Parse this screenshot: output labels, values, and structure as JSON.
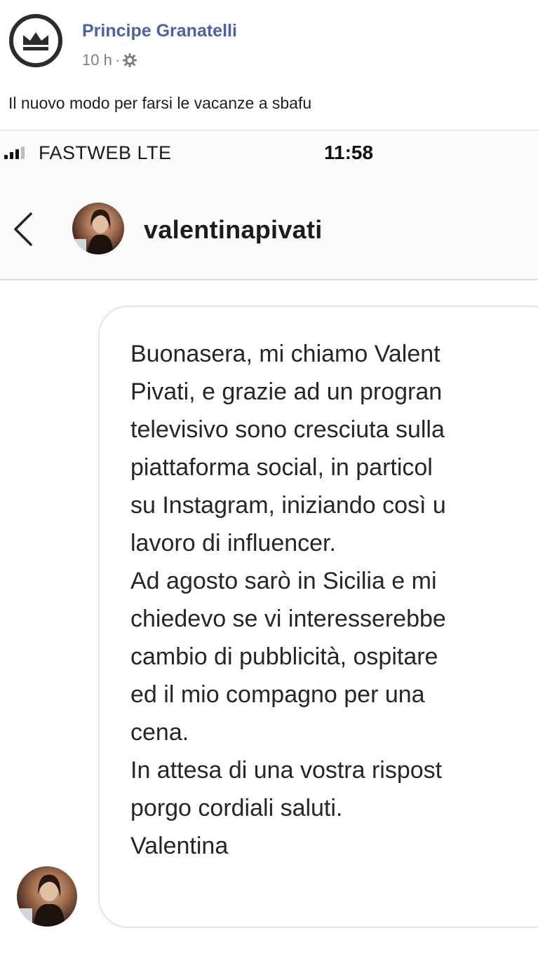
{
  "post": {
    "page_name": "Principe Granatelli",
    "time": "10 h",
    "separator": "·",
    "audience_icon": "gear-icon",
    "caption": "Il nuovo modo per farsi le vacanze a sbafu"
  },
  "phone": {
    "status_bar": {
      "carrier": "FASTWEB  LTE",
      "time": "11:58"
    },
    "chat_header": {
      "back_icon": "chevron-left-icon",
      "contact_name": "valentinapivati"
    },
    "message": {
      "lines": [
        "Buonasera, mi chiamo Valent",
        "Pivati, e grazie ad un progran",
        "televisivo sono cresciuta sulla",
        "piattaforma social, in particol",
        "su Instagram, iniziando così u",
        "lavoro di influencer.",
        "Ad agosto sarò in Sicilia e mi",
        "chiedevo se vi interesserebbe",
        "cambio di pubblicità, ospitare",
        "ed il mio compagno per una",
        "cena.",
        "In attesa di una vostra rispost",
        "porgo cordiali saluti.",
        "Valentina"
      ]
    }
  },
  "colors": {
    "page_name": "#4b62a3",
    "meta": "#7b7f86",
    "bubble_border": "#e4e4e4"
  }
}
